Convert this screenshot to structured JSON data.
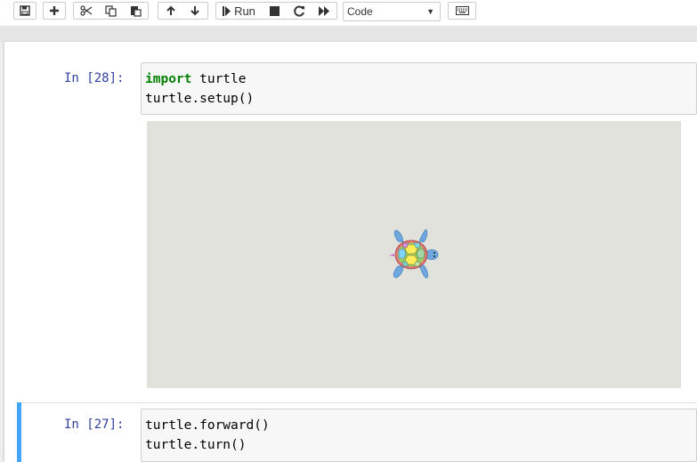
{
  "toolbar": {
    "buttons": [
      {
        "name": "save-button",
        "icon": "floppy-disk-icon"
      },
      {
        "name": "insert-cell-button",
        "icon": "plus-icon"
      },
      {
        "name": "cut-button",
        "icon": "scissors-icon"
      },
      {
        "name": "copy-button",
        "icon": "copy-icon"
      },
      {
        "name": "paste-button",
        "icon": "paste-icon"
      },
      {
        "name": "move-up-button",
        "icon": "arrow-up-icon"
      },
      {
        "name": "move-down-button",
        "icon": "arrow-down-icon"
      },
      {
        "name": "run-button",
        "icon": "step-forward-icon",
        "label": "Run"
      },
      {
        "name": "interrupt-button",
        "icon": "stop-icon"
      },
      {
        "name": "restart-button",
        "icon": "refresh-icon"
      },
      {
        "name": "restart-run-all-button",
        "icon": "fast-forward-icon"
      },
      {
        "name": "command-palette-button",
        "icon": "keyboard-icon"
      }
    ],
    "run_label": "Run",
    "cell_type": "Code"
  },
  "cells": [
    {
      "prompt": "In [28]:",
      "code_lines": [
        {
          "keyword": "import",
          "rest": " turtle"
        },
        {
          "keyword": "",
          "rest": "turtle.setup()"
        }
      ],
      "output": {
        "type": "turtle-canvas",
        "background": "#e2e2dd",
        "sprite": "turtle-icon"
      }
    },
    {
      "prompt": "In [27]:",
      "selected": true,
      "code_lines": [
        {
          "keyword": "",
          "rest": "turtle.forward()"
        },
        {
          "keyword": "",
          "rest": "turtle.turn()"
        }
      ]
    }
  ],
  "colors": {
    "prompt": "#303f9f",
    "keyword": "#008000",
    "selection": "#42a5f5",
    "canvas": "#e2e2dd"
  }
}
